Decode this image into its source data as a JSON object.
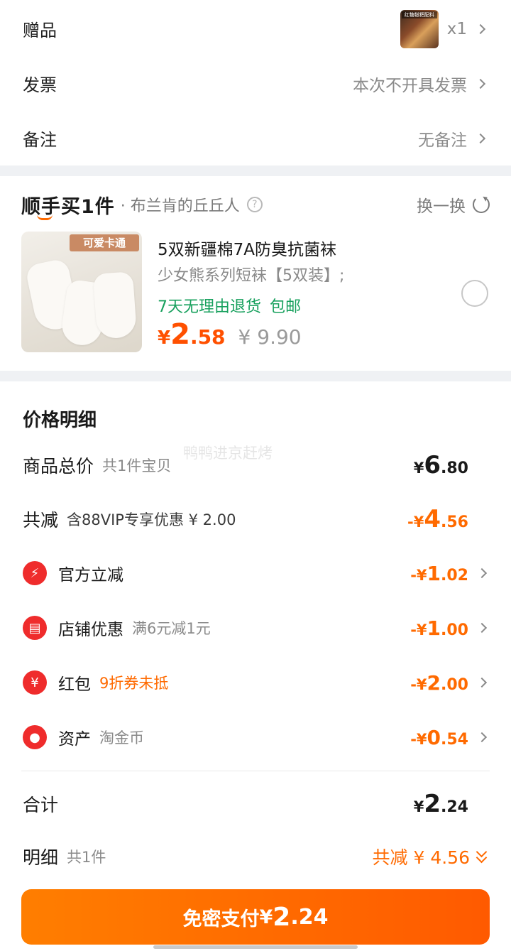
{
  "rows": {
    "gift": {
      "label": "赠品",
      "image_text": "红糖糍粑配料",
      "qty": "x1"
    },
    "invoice": {
      "label": "发票",
      "value": "本次不开具发票"
    },
    "remark": {
      "label": "备注",
      "value": "无备注"
    }
  },
  "addon": {
    "brand": "顺手买1件",
    "shop": "· 布兰肯的丘丘人",
    "help": "?",
    "swap": "换一换",
    "product": {
      "image_banner": "可爱卡通",
      "title": "5双新疆棉7A防臭抗菌袜",
      "subtitle": "少女熊系列短袜【5双装】;",
      "tags": [
        "7天无理由退货",
        "包邮"
      ],
      "price_currency": "¥",
      "price_int": "2",
      "price_dec": ".58",
      "original_price": "¥ 9.90"
    }
  },
  "price_detail": {
    "title": "价格明细",
    "watermark": "鸭鸭进京赶烤",
    "total": {
      "label": "商品总价",
      "note": "共1件宝贝",
      "cur": "¥",
      "int": "6",
      "dec": ".80"
    },
    "reduce": {
      "label": "共减",
      "note": "含88VIP专享优惠 ¥ 2.00",
      "cur": "-¥",
      "int": "4",
      "dec": ".56"
    },
    "items": [
      {
        "icon": "lightning-icon",
        "glyph": "⚡",
        "label": "官方立减",
        "note": "",
        "cur": "-¥",
        "int": "1",
        "dec": ".02"
      },
      {
        "icon": "store-icon",
        "glyph": "▤",
        "label": "店铺优惠",
        "note": "满6元减1元",
        "cur": "-¥",
        "int": "1",
        "dec": ".00"
      },
      {
        "icon": "red-envelope-icon",
        "glyph": "¥",
        "label": "红包",
        "note": "9折券未抵",
        "cur": "-¥",
        "int": "2",
        "dec": ".00"
      },
      {
        "icon": "tag-icon",
        "glyph": "●",
        "label": "资产",
        "note": "淘金币",
        "cur": "-¥",
        "int": "0",
        "dec": ".54"
      }
    ],
    "sum": {
      "label": "合计",
      "cur": "¥",
      "int": "2",
      "dec": ".24"
    },
    "detail": {
      "label": "明细",
      "note": "共1件",
      "value": "共减 ¥ 4.56"
    }
  },
  "pay": {
    "label": "免密支付",
    "cur": "¥",
    "int": "2",
    "dec": ".24"
  },
  "colors": {
    "accent": "#ff6a00",
    "green": "#17a05d",
    "red_icon": "#ef2c2c"
  }
}
